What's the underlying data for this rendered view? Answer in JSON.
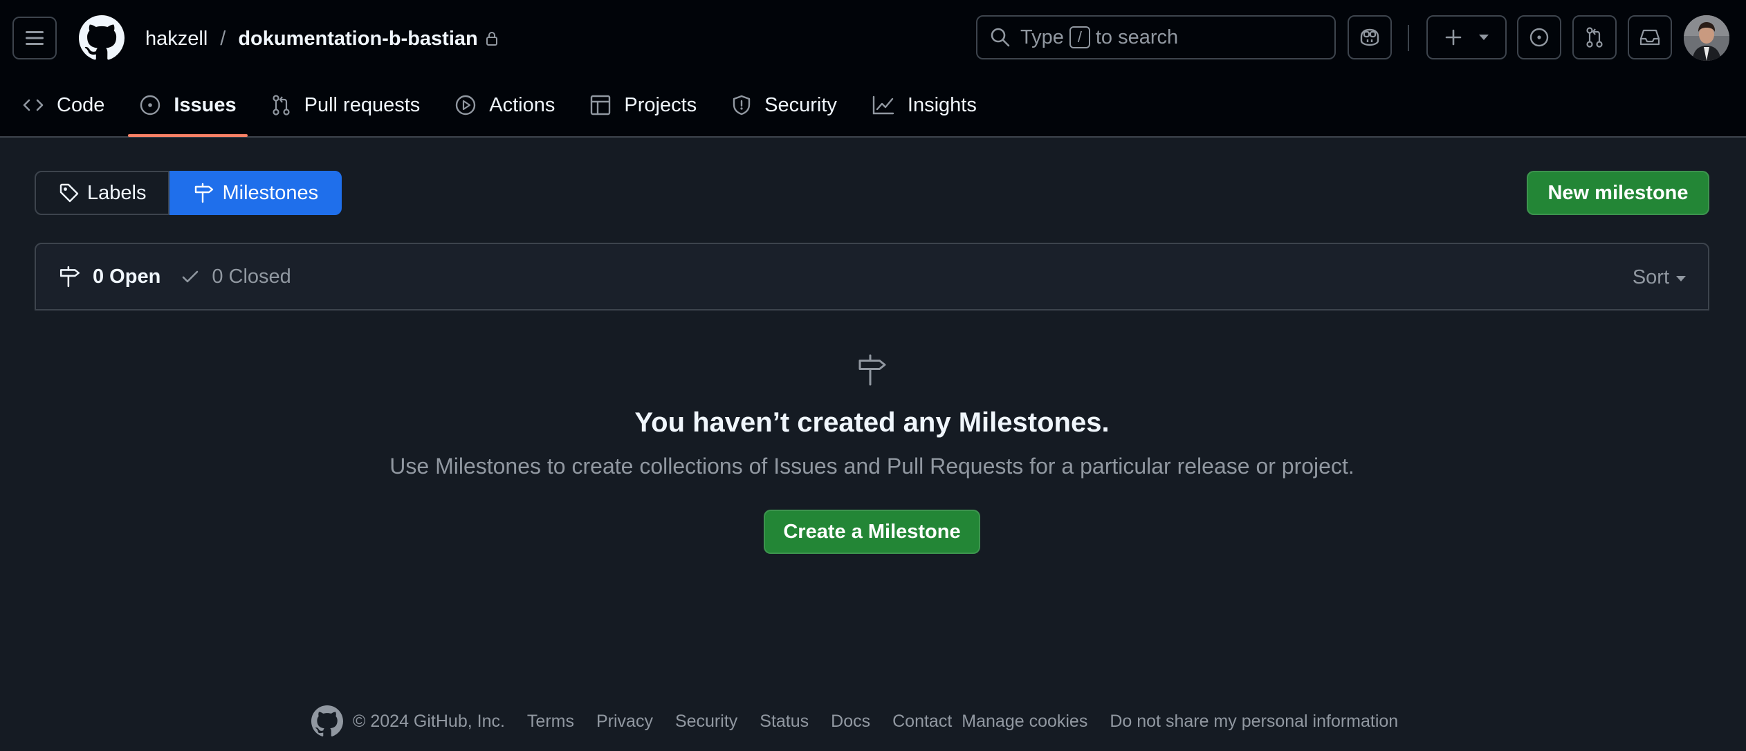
{
  "header": {
    "owner": "hakzell",
    "separator": "/",
    "repo": "dokumentation-b-bastian",
    "search_prefix": "Type",
    "search_key": "/",
    "search_suffix": "to search"
  },
  "tabs": [
    {
      "label": "Code",
      "icon": "code-icon"
    },
    {
      "label": "Issues",
      "icon": "issue-opened-icon",
      "active": true
    },
    {
      "label": "Pull requests",
      "icon": "git-pull-request-icon"
    },
    {
      "label": "Actions",
      "icon": "play-icon"
    },
    {
      "label": "Projects",
      "icon": "table-icon"
    },
    {
      "label": "Security",
      "icon": "shield-icon"
    },
    {
      "label": "Insights",
      "icon": "graph-icon"
    }
  ],
  "subnav": {
    "labels": "Labels",
    "milestones": "Milestones"
  },
  "new_milestone": "New milestone",
  "states": {
    "open": "0 Open",
    "closed": "0 Closed",
    "sort": "Sort"
  },
  "blankslate": {
    "title": "You haven’t created any Milestones.",
    "description": "Use Milestones to create collections of Issues and Pull Requests for a particular release or project.",
    "button": "Create a Milestone"
  },
  "footer": {
    "copyright": "© 2024 GitHub, Inc.",
    "links": [
      "Terms",
      "Privacy",
      "Security",
      "Status",
      "Docs",
      "Contact",
      "Manage cookies",
      "Do not share my personal information"
    ]
  },
  "colors": {
    "header_bg": "#010409",
    "page_bg": "#151b23",
    "accent_blue": "#1f6feb",
    "primary_green": "#238636",
    "tab_underline": "#f78166"
  }
}
